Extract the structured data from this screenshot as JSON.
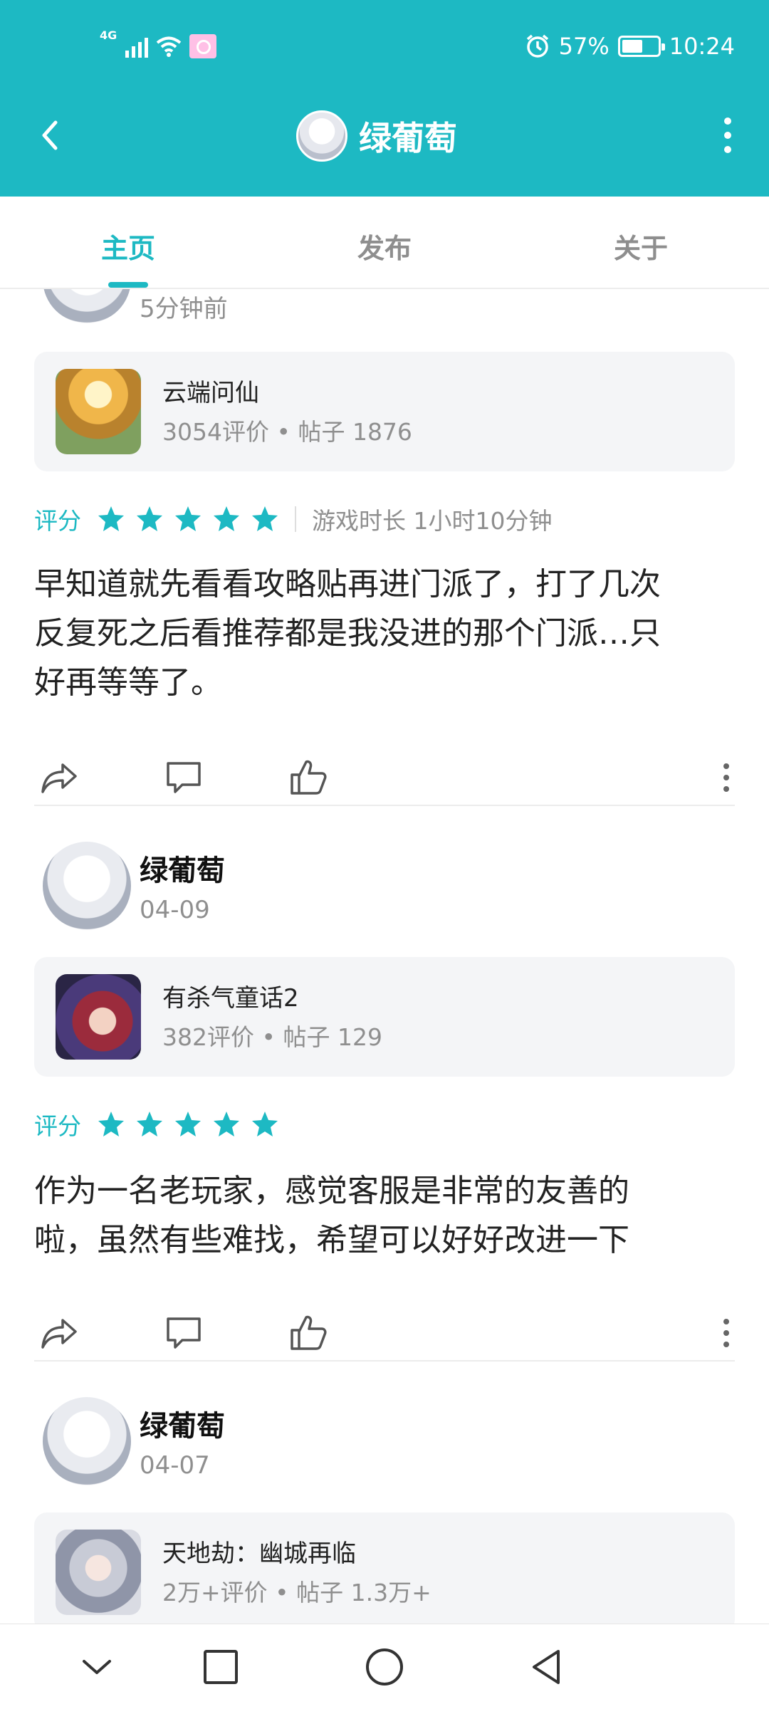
{
  "status_bar": {
    "network": "4G",
    "battery_percent": "57%",
    "time": "10:24",
    "battery_level": 0.57
  },
  "app_bar": {
    "title": "绿葡萄",
    "back_icon": "chevron-left-icon",
    "menu_icon": "more-vertical-icon"
  },
  "tabs": [
    {
      "label": "主页",
      "active": true
    },
    {
      "label": "发布",
      "active": false
    },
    {
      "label": "关于",
      "active": false
    }
  ],
  "posts": [
    {
      "time": "5分钟前",
      "game": {
        "name": "云端问仙",
        "ratings": "3054评价",
        "posts": "帖子 1876"
      },
      "rating_label": "评分",
      "stars": 5,
      "playtime": "游戏时长 1小时10分钟",
      "text_lines": [
        "早知道就先看看攻略贴再进门派了，打了几次",
        "反复死之后看推荐都是我没进的那个门派…只",
        "好再等等了。"
      ]
    },
    {
      "author": "绿葡萄",
      "time": "04-09",
      "game": {
        "name": "有杀气童话2",
        "ratings": "382评价",
        "posts": "帖子 129"
      },
      "rating_label": "评分",
      "stars": 5,
      "text_lines": [
        "作为一名老玩家，感觉客服是非常的友善的",
        "啦，虽然有些难找，希望可以好好改进一下"
      ]
    },
    {
      "author": "绿葡萄",
      "time": "04-07",
      "game": {
        "name": "天地劫：幽城再临",
        "ratings": "2万+评价",
        "posts": "帖子 1.3万+"
      }
    }
  ],
  "meta_separator": "•",
  "colors": {
    "accent": "#1db9c3",
    "card_bg": "#f4f5f7",
    "muted": "#8f8f8f"
  }
}
